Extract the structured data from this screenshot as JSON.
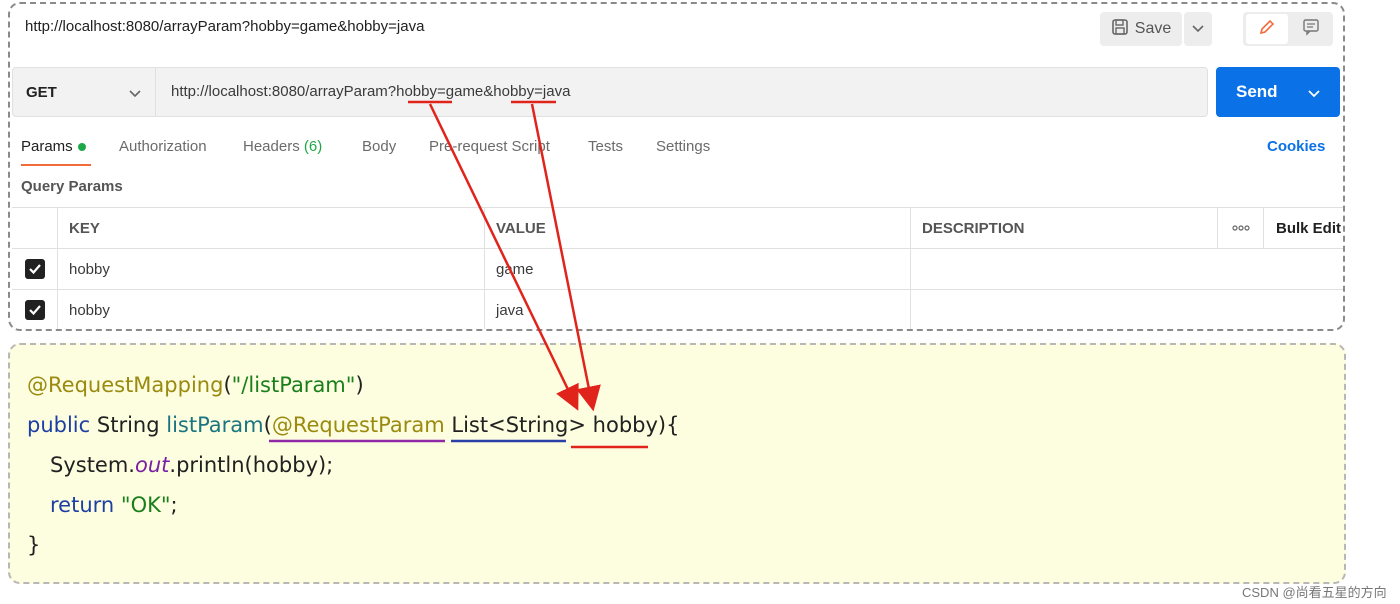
{
  "request_bar": {
    "title_url": "http://localhost:8080/arrayParam?hobby=game&hobby=java",
    "save_label": "Save"
  },
  "request": {
    "method": "GET",
    "url": "http://localhost:8080/arrayParam?hobby=game&hobby=java",
    "send_label": "Send"
  },
  "tabs": {
    "params": "Params",
    "authorization": "Authorization",
    "headers": "Headers",
    "headers_count": "(6)",
    "body": "Body",
    "prerequest": "Pre-request Script",
    "tests": "Tests",
    "settings": "Settings",
    "cookies": "Cookies"
  },
  "query_params": {
    "title": "Query Params",
    "headers": {
      "key": "KEY",
      "value": "VALUE",
      "description": "DESCRIPTION",
      "more": "ooo",
      "bulk_edit": "Bulk Edit"
    },
    "rows": [
      {
        "key": "hobby",
        "value": "game",
        "description": ""
      },
      {
        "key": "hobby",
        "value": "java",
        "description": ""
      }
    ]
  },
  "code": {
    "line1_annotation": "@RequestMapping",
    "line1_open": "(",
    "line1_string": "\"/listParam\"",
    "line1_close": ")",
    "line2_public": "public",
    "line2_type": "String",
    "line2_method": "listParam",
    "line2_paren": "(",
    "line2_annotation": "@RequestParam",
    "line2_list": "List<String>",
    "line2_param": "hobby",
    "line2_end": "){",
    "line3_system": "System.",
    "line3_out": "out",
    "line3_println": ".println(hobby);",
    "line4_return": "return",
    "line4_string": "\"OK\"",
    "line4_semicolon": ";",
    "line5_brace": "}"
  },
  "colors": {
    "send_blue": "#0a72e6",
    "tab_underline": "#f26b3a",
    "active_green": "#1fa847",
    "arrow_red": "#e0241b",
    "underline_purple": "#8e2aa8",
    "underline_blue": "#2b3fa8"
  },
  "watermark": "CSDN @尚看五星的方向"
}
